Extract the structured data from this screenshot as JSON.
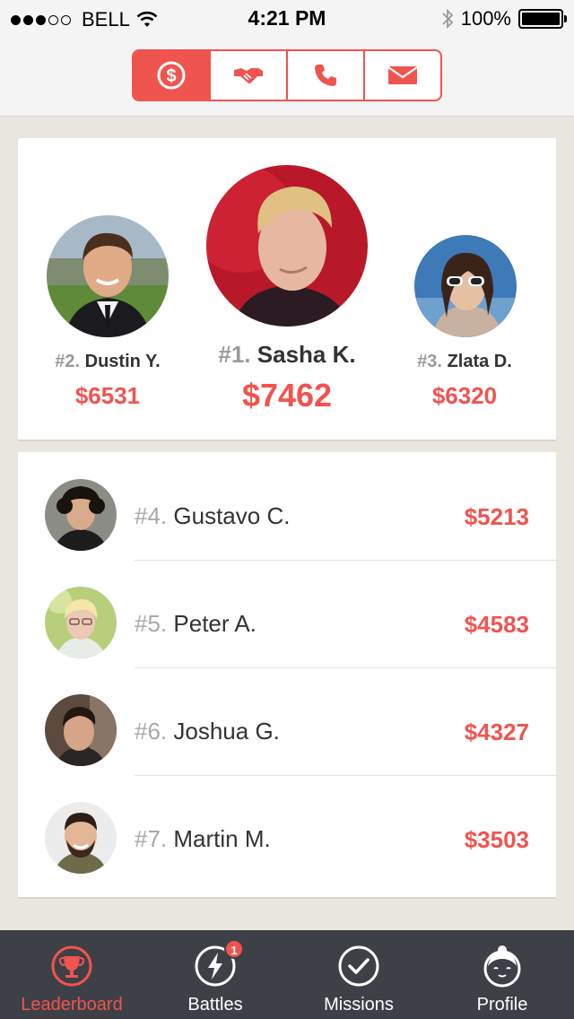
{
  "status_bar": {
    "carrier": "BELL",
    "time": "4:21 PM",
    "battery": "100%"
  },
  "segments": [
    {
      "icon": "dollar-icon",
      "active": true
    },
    {
      "icon": "handshake-icon",
      "active": false
    },
    {
      "icon": "phone-icon",
      "active": false
    },
    {
      "icon": "mail-icon",
      "active": false
    }
  ],
  "podium": {
    "first": {
      "rank": "#1.",
      "name": "Sasha K.",
      "amount": "$7462"
    },
    "second": {
      "rank": "#2.",
      "name": "Dustin Y.",
      "amount": "$6531"
    },
    "third": {
      "rank": "#3.",
      "name": "Zlata D.",
      "amount": "$6320"
    }
  },
  "leaderboard": [
    {
      "rank": "#4.",
      "name": "Gustavo C.",
      "amount": "$5213"
    },
    {
      "rank": "#5.",
      "name": "Peter A.",
      "amount": "$4583"
    },
    {
      "rank": "#6.",
      "name": "Joshua G.",
      "amount": "$4327"
    },
    {
      "rank": "#7.",
      "name": "Martin M.",
      "amount": "$3503"
    }
  ],
  "tabs": [
    {
      "label": "Leaderboard",
      "icon": "trophy-icon",
      "active": true
    },
    {
      "label": "Battles",
      "icon": "lightning-icon",
      "badge": "1"
    },
    {
      "label": "Missions",
      "icon": "check-icon"
    },
    {
      "label": "Profile",
      "icon": "profile-face-icon"
    }
  ],
  "colors": {
    "accent": "#f0544f",
    "tab_bar": "#3d4046",
    "background": "#e9e6e0"
  }
}
